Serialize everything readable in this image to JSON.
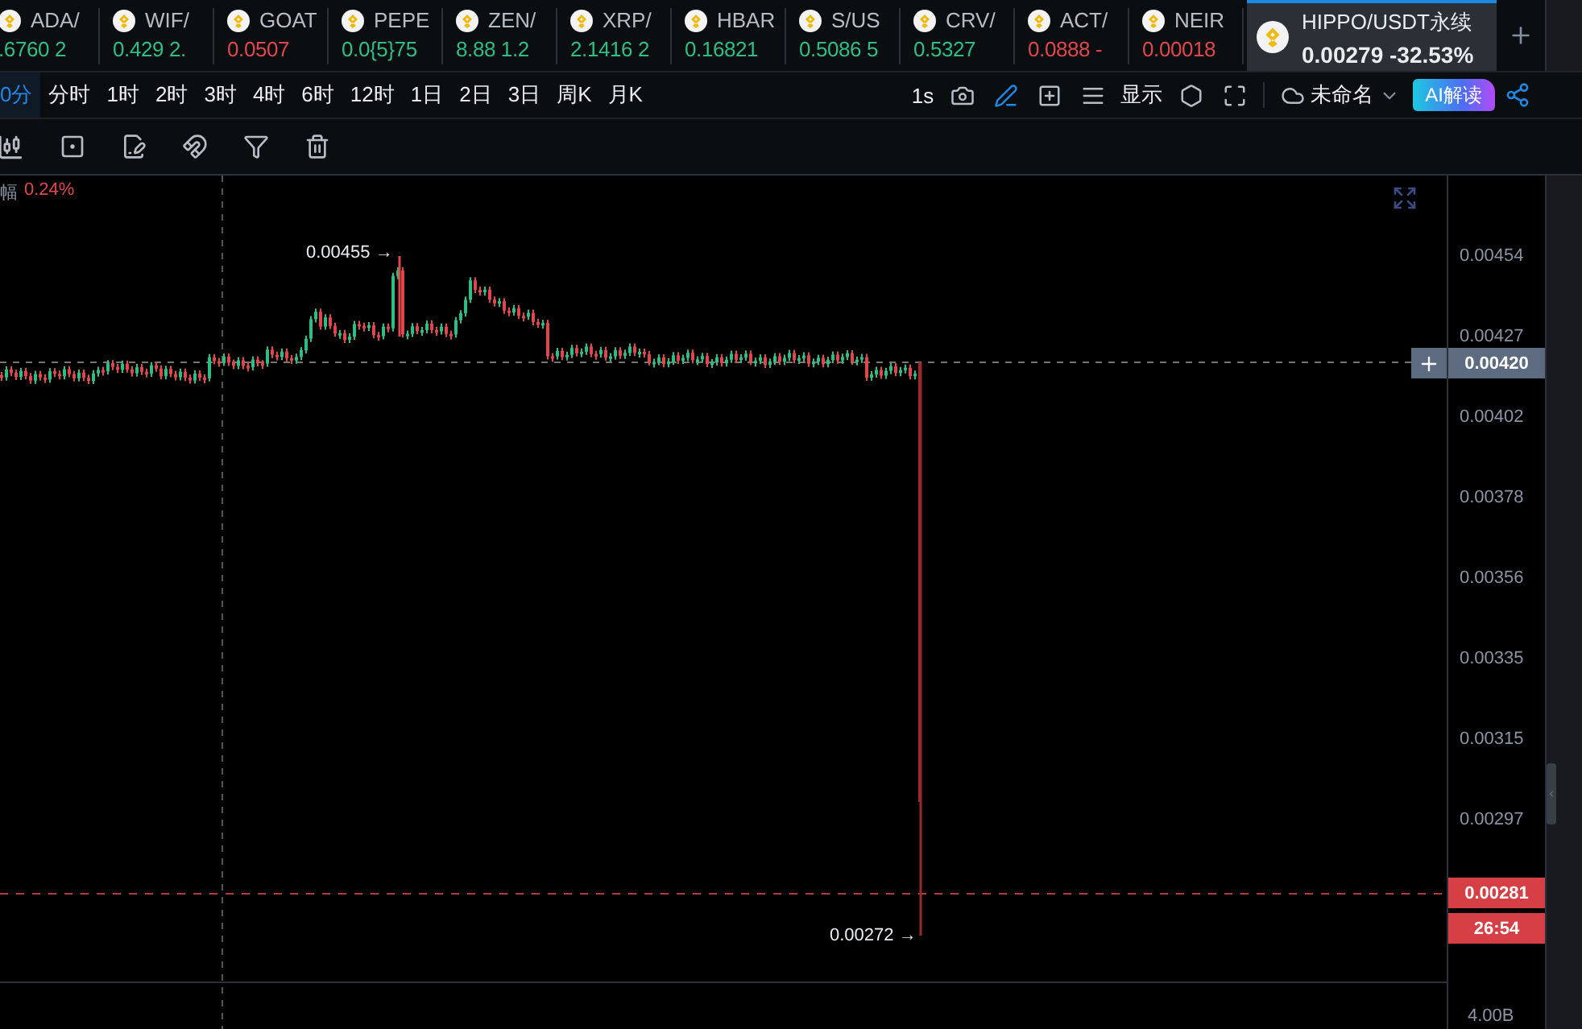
{
  "tickers": [
    {
      "symbol": "ADA/",
      "price": ".6760",
      "change": "2",
      "color": "#2ebd85"
    },
    {
      "symbol": "WIF/",
      "price": "0.429",
      "change": "2.",
      "color": "#2ebd85"
    },
    {
      "symbol": "GOAT",
      "price": "0.0507",
      "color": "#e0474c"
    },
    {
      "symbol": "PEPE",
      "price": "0.0{5}75",
      "color": "#2ebd85"
    },
    {
      "symbol": "ZEN/",
      "price": "8.88",
      "change": "1.2",
      "color": "#2ebd85"
    },
    {
      "symbol": "XRP/",
      "price": "2.1416",
      "change": "2",
      "color": "#2ebd85"
    },
    {
      "symbol": "HBAR",
      "price": "0.16821",
      "color": "#2ebd85"
    },
    {
      "symbol": "S/US",
      "price": "0.5086",
      "change": "5",
      "color": "#2ebd85"
    },
    {
      "symbol": "CRV/",
      "price": "0.5327",
      "color": "#2ebd85"
    },
    {
      "symbol": "ACT/",
      "price": "0.0888",
      "change": "-",
      "color": "#e0474c"
    },
    {
      "symbol": "NEIR",
      "price": "0.00018",
      "color": "#e0474c"
    }
  ],
  "active_ticker": {
    "symbol": "HIPPO/USDT永续",
    "price": "0.00279",
    "change": "-32.53%"
  },
  "timeframes": [
    {
      "label": "0分",
      "selected": true
    },
    {
      "label": "分时",
      "selected": false
    },
    {
      "label": "1时",
      "selected": false
    },
    {
      "label": "2时",
      "selected": false
    },
    {
      "label": "3时",
      "selected": false
    },
    {
      "label": "4时",
      "selected": false
    },
    {
      "label": "6时",
      "selected": false
    },
    {
      "label": "12时",
      "selected": false
    },
    {
      "label": "1日",
      "selected": false
    },
    {
      "label": "2日",
      "selected": false
    },
    {
      "label": "3日",
      "selected": false
    },
    {
      "label": "周K",
      "selected": false
    },
    {
      "label": "月K",
      "selected": false
    }
  ],
  "chart_toolbar": {
    "interval": "1s",
    "display_label": "显示",
    "layout_name": "未命名",
    "ai_button": "AI解读"
  },
  "chart": {
    "legend_label": "幅",
    "legend_value": "0.24%",
    "high_label": "0.00455 →",
    "low_label": "0.00272 →",
    "price_axis": [
      "0.00454",
      "0.00427",
      "0.00402",
      "0.00378",
      "0.00356",
      "0.00335",
      "0.00315",
      "0.00297"
    ],
    "crosshair_price": "0.00420",
    "last_price": "0.00281",
    "countdown": "26:54",
    "volume_axis": "4.00B"
  }
}
